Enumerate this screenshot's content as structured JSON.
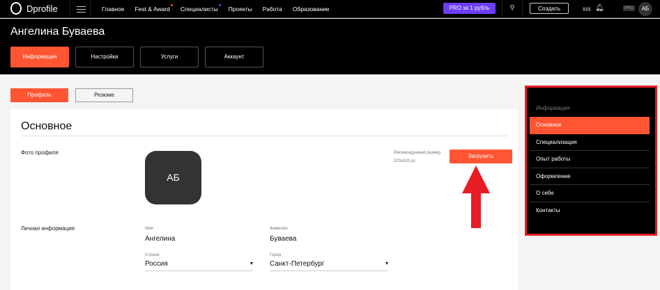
{
  "header": {
    "logo": "Dprofile",
    "nav": [
      "Главное",
      "Fest & Award",
      "Специалисты",
      "Проекты",
      "Работа",
      "Образование"
    ],
    "pro": "PRO за 1 рубль",
    "create": "Создать",
    "pro_badge": "PRO",
    "avatar": "АБ"
  },
  "profile": {
    "name": "Ангелина Буваева",
    "tabs": [
      "Информация",
      "Настройки",
      "Услуги",
      "Аккаунт"
    ]
  },
  "subtabs": [
    "Профиль",
    "Резюме"
  ],
  "card": {
    "title": "Основное",
    "photo_label": "Фото профиля",
    "photo_initials": "АБ",
    "rec_line1": "Рекомендуемый размер",
    "rec_line2": "320x320 px",
    "upload": "Загрузить",
    "personal_label": "Личная информация",
    "fields": [
      {
        "label": "Имя",
        "value": "Ангелина"
      },
      {
        "label": "Фамилия",
        "value": "Буваева"
      },
      {
        "label": "Страна",
        "value": "Россия"
      },
      {
        "label": "Город",
        "value": "Санкт-Петербург"
      }
    ]
  },
  "sidebar": {
    "heading": "Информация",
    "items": [
      "Основное",
      "Специализация",
      "Опыт работы",
      "Оформление",
      "О себе",
      "Контакты"
    ]
  },
  "colors": {
    "accent": "#ff5533",
    "pro": "#6b3ff5",
    "highlight": "#e81c24"
  }
}
